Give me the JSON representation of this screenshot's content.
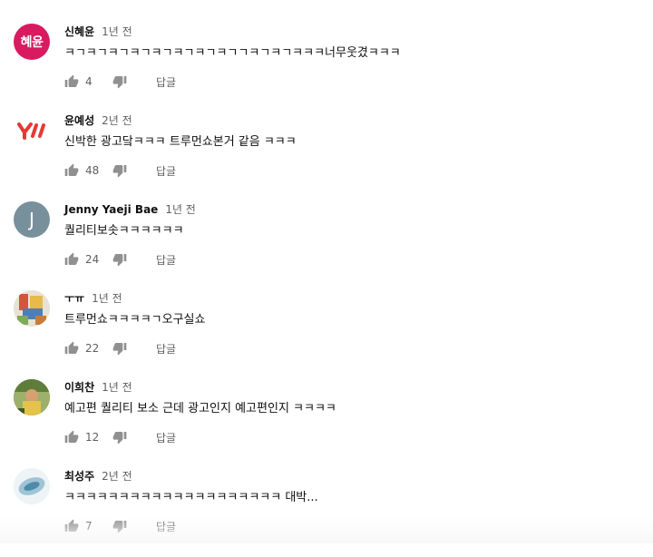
{
  "comments": [
    {
      "author": "신혜윤",
      "time": "1년 전",
      "text": "ㅋㄱㅋㄱㅋㄱㅋㄱㅋㄱㅋㄱㅋㄱㅋㄱㄱㅋㄱㅋㄱㅋㅋㅋ너무웃겼ㅋㅋㅋ",
      "likes": "4",
      "reply_label": "답글",
      "avatar_text": "혜윤",
      "avatar_color": "#d81b60"
    },
    {
      "author": "윤예성",
      "time": "2년 전",
      "text": "신박한 광고닼ㅋㅋㅋ 트루먼쇼본거 같음 ㅋㅋㅋ",
      "likes": "48",
      "reply_label": "답글",
      "avatar_text": "Y",
      "avatar_color": "#ffffff"
    },
    {
      "author": "Jenny Yaeji Bae",
      "time": "1년 전",
      "text": "퀄리티보솟ㅋㅋㅋㅋㅋㅋ",
      "likes": "24",
      "reply_label": "답글",
      "avatar_text": "J",
      "avatar_color": "#78909c"
    },
    {
      "author": "ㅜㅠ",
      "time": "1년 전",
      "text": "트루먼쇼ㅋㅋㅋㅋㄱ오구실쇼",
      "likes": "22",
      "reply_label": "답글",
      "avatar_text": "",
      "avatar_color": "#c9b28a"
    },
    {
      "author": "이희찬",
      "time": "1년 전",
      "text": "예고편 퀄리티 보소 근데 광고인지 예고편인지 ㅋㅋㅋㅋ",
      "likes": "12",
      "reply_label": "답글",
      "avatar_text": "",
      "avatar_color": "#6b8a3a"
    },
    {
      "author": "최성주",
      "time": "2년 전",
      "text": "ㅋㅋㅋㅋㅋㅋㅋㅋㅋㅋㅋㅋㅋㅋㅋㅋㅋㅋㅋㅋ 대박...",
      "likes": "7",
      "reply_label": "답글",
      "avatar_text": "",
      "avatar_color": "#d7e8f0"
    }
  ]
}
